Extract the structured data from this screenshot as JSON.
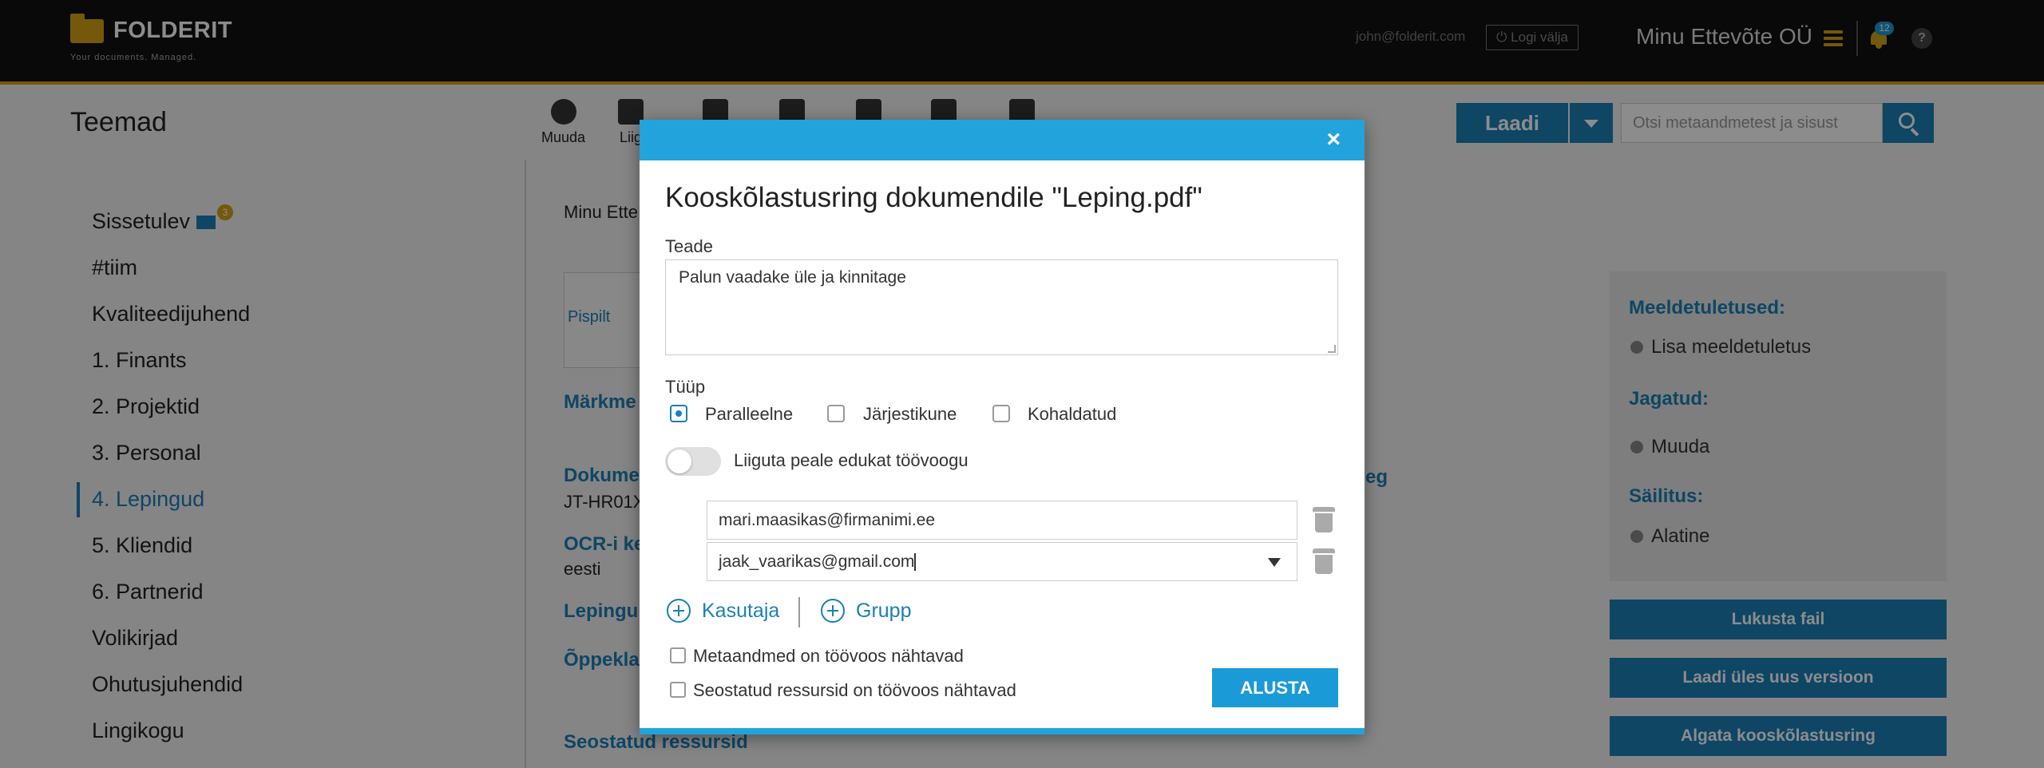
{
  "header": {
    "logo_text": "FOLDERIT",
    "logo_tagline": "Your documents. Managed.",
    "user_email": "john@folderit.com",
    "logout_label": "Logi välja",
    "company_name": "Minu Ettevõte OÜ",
    "notifications_count": "12",
    "help_label": "?"
  },
  "toolbar": {
    "page_title": "Teemad",
    "tools": [
      {
        "label": "Muuda",
        "icon": "gear-icon"
      },
      {
        "label": "Liig",
        "icon": "folder-move-icon"
      },
      {
        "label": "",
        "icon": "share-icon"
      },
      {
        "label": "",
        "icon": "bell-icon"
      },
      {
        "label": "",
        "icon": "binoculars-icon"
      },
      {
        "label": "",
        "icon": "copy-icon"
      },
      {
        "label": "",
        "icon": "trash-icon"
      }
    ],
    "upload_label": "Laadi",
    "search_placeholder": "Otsi metaandmetest ja sisust"
  },
  "sidebar": {
    "items": [
      {
        "label": "Sissetulev",
        "badge": "3"
      },
      {
        "label": "#tiim"
      },
      {
        "label": "Kvaliteedijuhend"
      },
      {
        "label": "1. Finants"
      },
      {
        "label": "2. Projektid"
      },
      {
        "label": "3. Personal"
      },
      {
        "label": "4. Lepingud",
        "active": true
      },
      {
        "label": "5. Kliendid"
      },
      {
        "label": "6. Partnerid"
      },
      {
        "label": "Volikirjad"
      },
      {
        "label": "Ohutusjuhendid"
      },
      {
        "label": "Lingikogu"
      }
    ]
  },
  "main": {
    "breadcrumb": "Minu Ette",
    "thumb_alt": "Pispilt",
    "labels": {
      "markmed": "Märkme",
      "dokume": "Dokume",
      "doc_code": "JT-HR01X",
      "ocr": "OCR-i ke",
      "ocr_lang": "eesti",
      "lepingu": "Lepingu",
      "oppekla": "Õppekla",
      "seostatud": "Seostatud ressursid",
      "eg": "eg"
    }
  },
  "right_panel": {
    "reminders_label": "Meeldetuletused:",
    "add_reminder": "Lisa meeldetuletus",
    "shared_label": "Jagatud:",
    "shared_edit": "Muuda",
    "retention_label": "Säilitus:",
    "retention_value": "Alatine",
    "buttons": [
      "Lukusta fail",
      "Laadi üles uus versioon",
      "Algata kooskõlastusring"
    ]
  },
  "modal": {
    "close_label": "×",
    "title": "Kooskõlastusring dokumendile \"Leping.pdf\"",
    "message_label": "Teade",
    "message_value": "Palun vaadake üle ja kinnitage",
    "type_label": "Tüüp",
    "type_options": [
      {
        "label": "Paralleelne",
        "checked": true
      },
      {
        "label": "Järjestikune",
        "checked": false
      },
      {
        "label": "Kohaldatud",
        "checked": false
      }
    ],
    "toggle_label": "Liiguta peale edukat töövoogu",
    "toggle_on": false,
    "recipients": [
      "mari.maasikas@firmanimi.ee",
      "jaak_vaarikas@gmail.com"
    ],
    "add_user_label": "Kasutaja",
    "add_group_label": "Grupp",
    "checkbox_metadata": "Metaandmed on töövoos nähtavad",
    "checkbox_related": "Seostatud ressursid on töövoos nähtavad",
    "submit_label": "ALUSTA"
  },
  "colors": {
    "accent_blue": "#1a80b6",
    "modal_header": "#22a3dc",
    "brand_gold": "#d4a017",
    "topbar": "#111111"
  }
}
